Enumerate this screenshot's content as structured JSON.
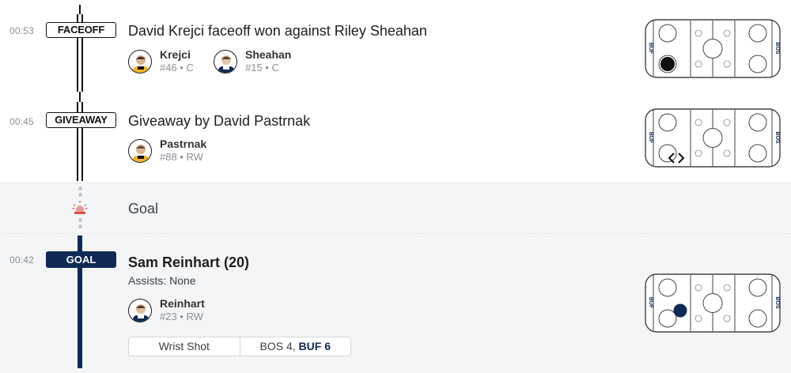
{
  "events": {
    "faceoff": {
      "time": "00:53",
      "badge": "FACEOFF",
      "title": "David Krejci faceoff won against Riley Sheahan",
      "players": [
        {
          "name": "Krejci",
          "meta": "#46 • C"
        },
        {
          "name": "Sheahan",
          "meta": "#15 • C"
        }
      ],
      "rink": {
        "left_team": "BUF",
        "right_team": "BOS",
        "marker": "puck-black"
      }
    },
    "giveaway": {
      "time": "00:45",
      "badge": "GIVEAWAY",
      "title": "Giveaway by David Pastrnak",
      "players": [
        {
          "name": "Pastrnak",
          "meta": "#88 • RW"
        }
      ],
      "rink": {
        "left_team": "BUF",
        "right_team": "BOS",
        "marker": "giveaway-arrows"
      }
    },
    "goal_alert": {
      "label": "Goal"
    },
    "goal": {
      "time": "00:42",
      "badge": "GOAL",
      "title": "Sam Reinhart (20)",
      "assists": "Assists: None",
      "players": [
        {
          "name": "Reinhart",
          "meta": "#23 • RW"
        }
      ],
      "shot_type": "Wrist Shot",
      "score_prefix": "BOS 4, ",
      "score_strong": "BUF 6",
      "rink": {
        "left_team": "BUF",
        "right_team": "BOS",
        "marker": "puck-navy"
      }
    }
  },
  "colors": {
    "navy": "#0e2a55",
    "line": "#111111",
    "bg_goal": "#f4f5f6",
    "alert_red": "#d9534f"
  }
}
